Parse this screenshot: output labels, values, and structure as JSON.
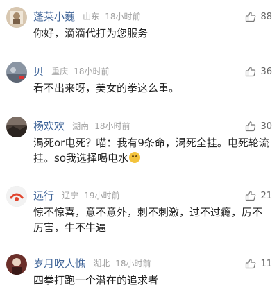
{
  "comments": [
    {
      "name": "蓬莱小巍",
      "location": "山东",
      "time": "18小时前",
      "likes": "88",
      "lines": [
        "你好，滴滴代打为您服务"
      ],
      "avatar_color": "#d8c7b0"
    },
    {
      "name": "贝",
      "location": "重庆",
      "time": "18小时前",
      "likes": "36",
      "lines": [
        "看不出来呀，美女的拳这么重。"
      ],
      "avatar_color": "#8a95a3"
    },
    {
      "name": "杨欢欢",
      "location": "湖南",
      "time": "18小时前",
      "likes": "30",
      "lines": [
        "渴死or电死？喵：我有9条命，渴死全挂。电死轮流",
        "挂。so我选择喝电水"
      ],
      "avatar_color": "#4a3f38"
    },
    {
      "name": "远行",
      "location": "辽宁",
      "time": "19小时前",
      "likes": "21",
      "lines": [
        "惊不惊喜，意不意外，刺不刺激，过不过瘾，厉不",
        "厉害，牛不牛逼"
      ],
      "avatar_color": "#f2f2f2"
    },
    {
      "name": "岁月吹人憔",
      "location": "湖北",
      "time": "18小时前",
      "likes": "11",
      "lines": [
        "四拳打跑一个潜在的追求者"
      ],
      "avatar_color": "#6b2f2a"
    }
  ]
}
